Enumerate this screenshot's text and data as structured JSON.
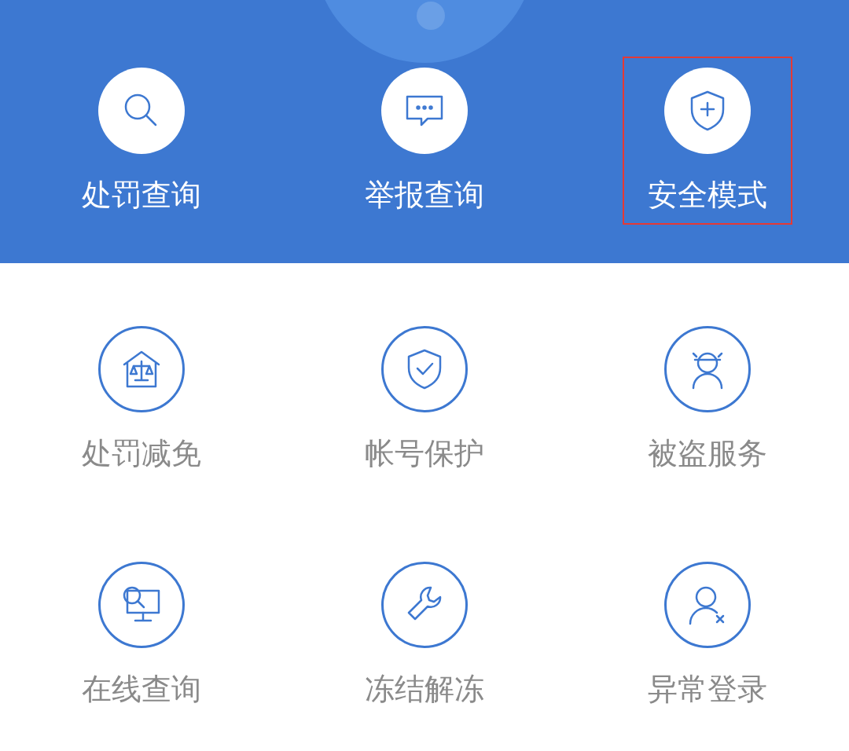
{
  "header_items": [
    {
      "label": "处罚查询",
      "highlighted": false
    },
    {
      "label": "举报查询",
      "highlighted": false
    },
    {
      "label": "安全模式",
      "highlighted": true
    }
  ],
  "services": [
    {
      "label": "处罚减免"
    },
    {
      "label": "帐号保护"
    },
    {
      "label": "被盗服务"
    },
    {
      "label": "在线查询"
    },
    {
      "label": "冻结解冻"
    },
    {
      "label": "异常登录"
    }
  ]
}
